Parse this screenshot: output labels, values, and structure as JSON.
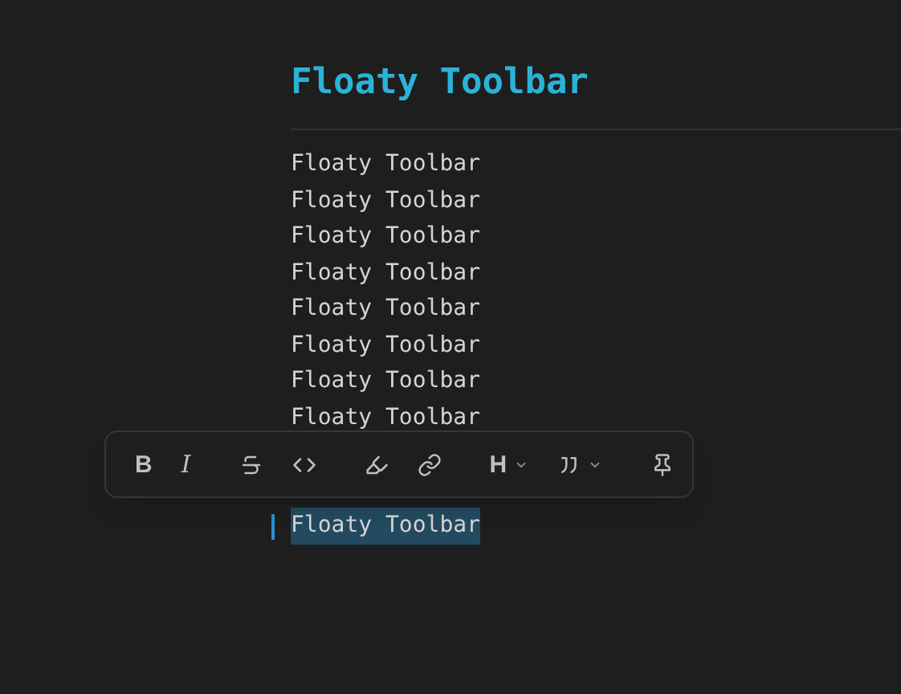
{
  "heading": "Floaty Toolbar",
  "lines": [
    "Floaty Toolbar",
    "Floaty Toolbar",
    "Floaty Toolbar",
    "Floaty Toolbar",
    "Floaty Toolbar",
    "Floaty Toolbar",
    "Floaty Toolbar",
    "Floaty Toolbar"
  ],
  "selected_line": {
    "text": "Floaty Toolbar",
    "selected": true
  },
  "toolbar": {
    "groups": [
      [
        {
          "kind": "bold",
          "label": "B"
        },
        {
          "kind": "italic",
          "label": "I"
        }
      ],
      [
        {
          "kind": "strike"
        },
        {
          "kind": "code"
        }
      ],
      [
        {
          "kind": "highlight"
        },
        {
          "kind": "link"
        }
      ],
      [
        {
          "kind": "bold",
          "label": "H",
          "dropdown": true
        },
        {
          "kind": "quote",
          "dropdown": true
        }
      ],
      [
        {
          "kind": "pin"
        }
      ]
    ]
  }
}
